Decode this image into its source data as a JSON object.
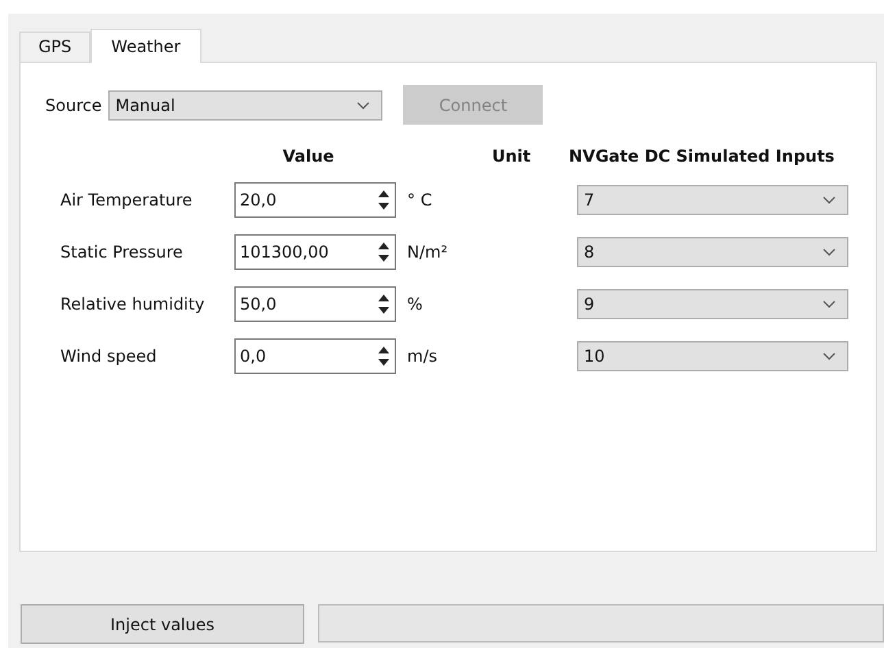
{
  "tabs": [
    {
      "label": "GPS",
      "selected": false
    },
    {
      "label": "Weather",
      "selected": true
    }
  ],
  "source": {
    "label": "Source",
    "value": "Manual",
    "connect_button": {
      "label": "Connect",
      "disabled": true
    }
  },
  "columns": [
    "Value",
    "Unit",
    "NVGate DC Simulated Inputs"
  ],
  "rows": [
    {
      "label": "Air Temperature",
      "value": "20,0",
      "unit": "° C",
      "input": "7"
    },
    {
      "label": "Static Pressure",
      "value": "101300,00",
      "unit": "N/m²",
      "input": "8"
    },
    {
      "label": "Relative humidity",
      "value": "50,0",
      "unit": "%",
      "input": "9"
    },
    {
      "label": "Wind speed",
      "value": "0,0",
      "unit": "m/s",
      "input": "10"
    }
  ],
  "inject_button": "Inject values"
}
